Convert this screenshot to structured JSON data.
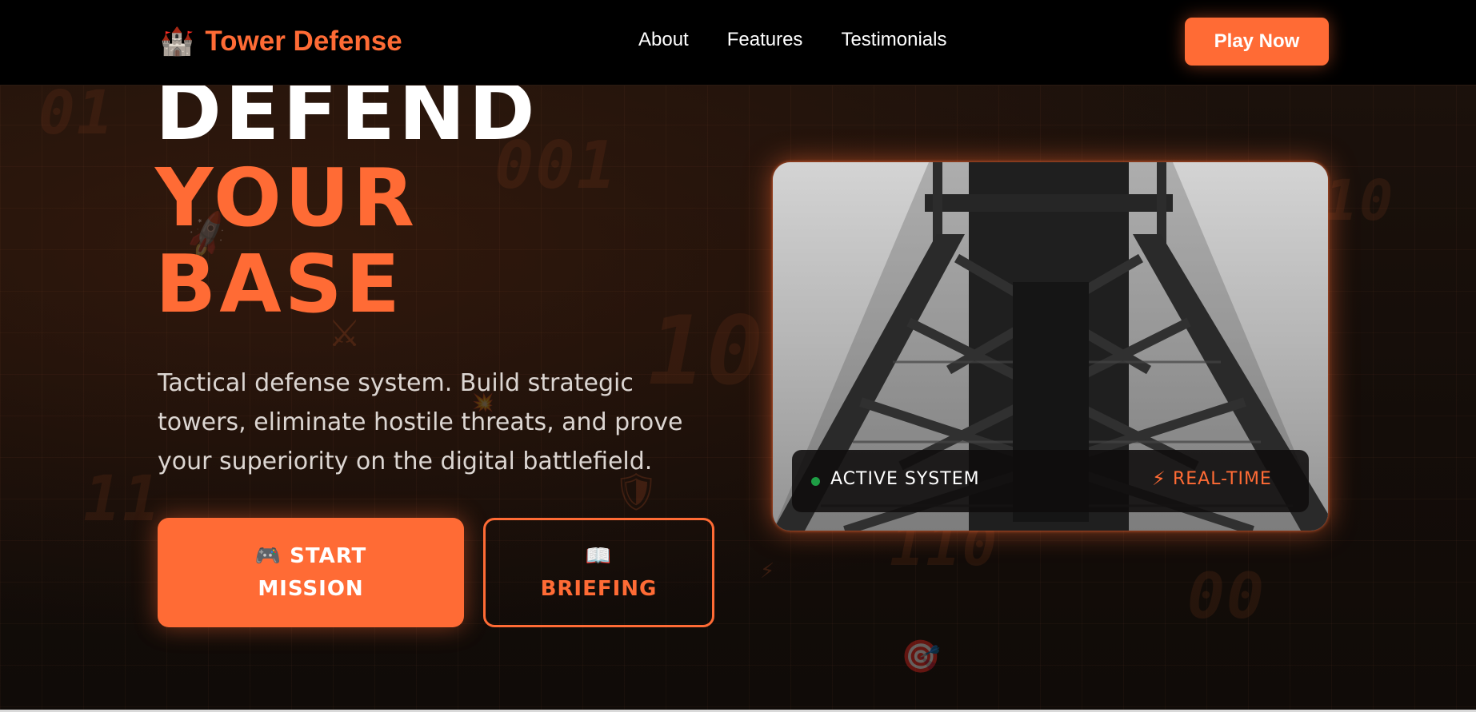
{
  "header": {
    "brand_icon": "🏰",
    "brand_name": "Tower Defense",
    "nav": [
      "About",
      "Features",
      "Testimonials"
    ],
    "cta": "Play Now"
  },
  "hero": {
    "headline": [
      "DEFEND",
      "YOUR",
      "BASE"
    ],
    "description": "Tactical defense system. Build strategic towers, eliminate hostile threats, and prove your superiority on the digital battlefield.",
    "primary_button": {
      "icon": "🎮",
      "line1": "START",
      "line2": "MISSION"
    },
    "secondary_button": {
      "icon": "📖",
      "line1": "BRIEFING"
    }
  },
  "card": {
    "image": "steel-tower-photo",
    "status_left": "ACTIVE SYSTEM",
    "status_right": "REAL-TIME",
    "status_icon": "bolt-icon"
  },
  "background_digits": [
    "01",
    "001",
    "10",
    "10",
    "11",
    "110",
    "00"
  ],
  "colors": {
    "accent": "#ff6b35",
    "background": "#120c09",
    "status_green": "#1e9e45"
  }
}
